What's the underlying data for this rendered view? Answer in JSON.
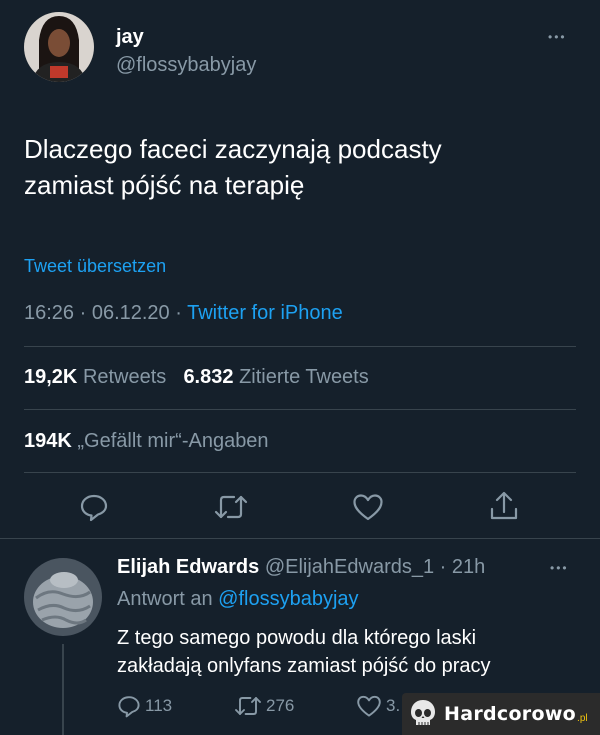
{
  "tweet": {
    "author_name": "jay",
    "author_handle": "@flossybabyjay",
    "more_label": "•••",
    "text_line1": "Dlaczego faceci zaczynają podcasty",
    "text_line2": "zamiast pójść na terapię",
    "translate_label": "Tweet übersetzen",
    "meta_time": "16:26 · 06.12.20 · ",
    "meta_source": "Twitter for iPhone",
    "retweets_count": "19,2K",
    "retweets_label": "Retweets",
    "quotes_count": "6.832",
    "quotes_label": "Zitierte Tweets",
    "likes_count": "194K",
    "likes_label": "„Gefällt mir“-Angaben"
  },
  "reply": {
    "author_name": "Elijah Edwards",
    "author_handle_time": "@ElijahEdwards_1 · 21h",
    "more_label": "•••",
    "reply_to_prefix": "Antwort an ",
    "reply_to_handle": "@flossybabyjay",
    "text_line1": "Z tego samego powodu dla którego laski",
    "text_line2": "zakładają onlyfans zamiast pójść do pracy",
    "replies_count": "113",
    "retweets_count": "276",
    "likes_count": "3."
  },
  "watermark": {
    "text": "Hardcorowo",
    "suffix": ".pl"
  },
  "colors": {
    "background": "#15202b",
    "accent": "#1da1f2",
    "muted": "#8899a6",
    "divider": "#38444d"
  },
  "icons": [
    "reply-icon",
    "retweet-icon",
    "like-icon",
    "share-icon",
    "more-icon",
    "skull-icon"
  ]
}
